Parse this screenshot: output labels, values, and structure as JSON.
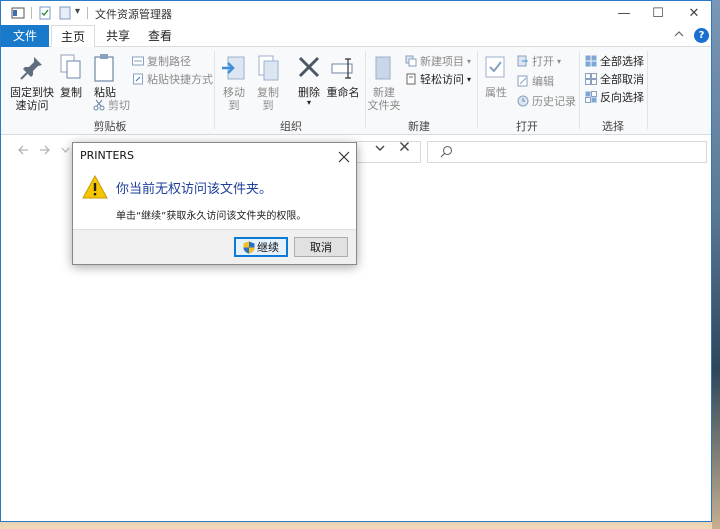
{
  "window": {
    "title": "文件资源管理器",
    "quick_access_dropdown": "▾"
  },
  "window_controls": {
    "minimize": "—",
    "maximize": "☐",
    "close": "✕"
  },
  "tabs": {
    "file": "文件",
    "home": "主页",
    "share": "共享",
    "view": "查看"
  },
  "ribbon": {
    "clipboard": {
      "label": "剪贴板",
      "pin_line1": "固定到快",
      "pin_line2": "速访问",
      "copy": "复制",
      "paste": "粘贴",
      "copy_path": "复制路径",
      "paste_shortcut": "粘贴快捷方式",
      "cut": "剪切"
    },
    "organize": {
      "label": "组织",
      "move_to": "移动到",
      "copy_to": "复制到",
      "delete": "删除",
      "rename": "重命名"
    },
    "new": {
      "label": "新建",
      "new_folder_line1": "新建",
      "new_folder_line2": "文件夹",
      "new_item": "新建项目",
      "easy_access": "轻松访问"
    },
    "open": {
      "label": "打开",
      "properties": "属性",
      "open": "打开",
      "edit": "编辑",
      "history": "历史记录"
    },
    "select": {
      "label": "选择",
      "select_all": "全部选择",
      "select_none": "全部取消",
      "invert": "反向选择"
    }
  },
  "dialog": {
    "title": "PRINTERS",
    "main_text": "你当前无权访问该文件夹。",
    "sub_text": "单击“继续”获取永久访问该文件夹的权限。",
    "continue_label": "继续",
    "cancel_label": "取消"
  },
  "colors": {
    "accent": "#1979ca",
    "dialog_text": "#1e3e9a",
    "warning": "#f7c600"
  }
}
